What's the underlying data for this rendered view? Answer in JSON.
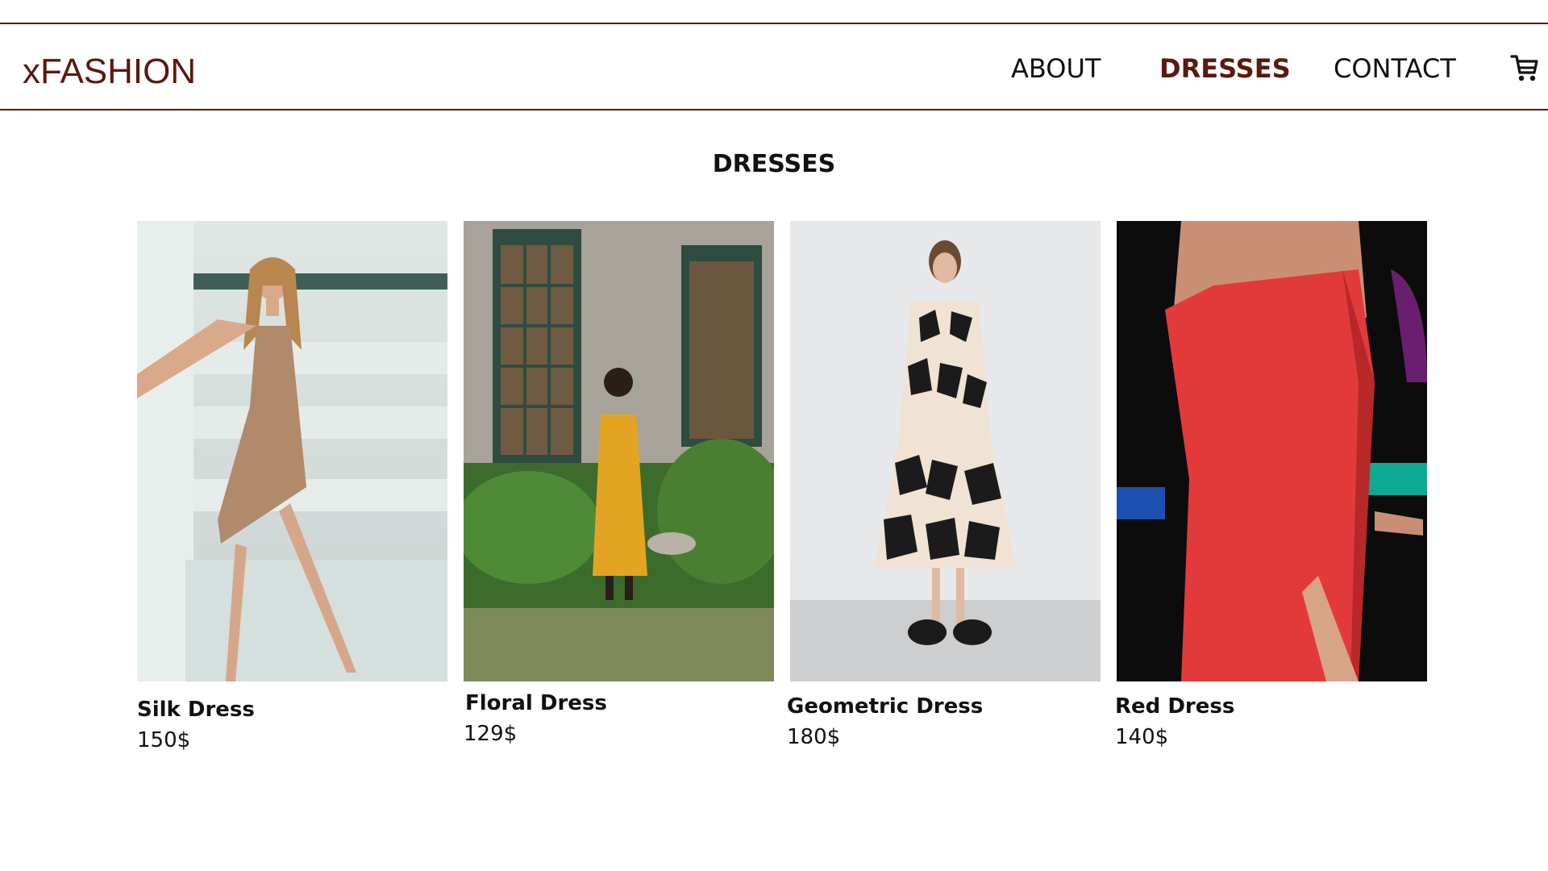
{
  "brand": {
    "logo": "xFASHION"
  },
  "nav": {
    "items": [
      {
        "label": "ABOUT",
        "active": false
      },
      {
        "label": "DRESSES",
        "active": true
      },
      {
        "label": "CONTACT",
        "active": false
      }
    ],
    "cart_icon": "shopping-cart-icon"
  },
  "page": {
    "title": "DRESSES"
  },
  "products": [
    {
      "name": "Silk Dress",
      "price": "150$",
      "image_desc": "model in beige satin slip dress against white inflatable backdrop"
    },
    {
      "name": "Floral Dress",
      "price": "129$",
      "image_desc": "model in yellow embroidered dress in garden near windows"
    },
    {
      "name": "Geometric Dress",
      "price": "180$",
      "image_desc": "model in black and white geometric print midi dress"
    },
    {
      "name": "Red Dress",
      "price": "140$",
      "image_desc": "model in red one-shoulder ruched dress"
    }
  ],
  "colors": {
    "accent": "#5a1a0e",
    "text": "#111111",
    "background": "#ffffff"
  }
}
